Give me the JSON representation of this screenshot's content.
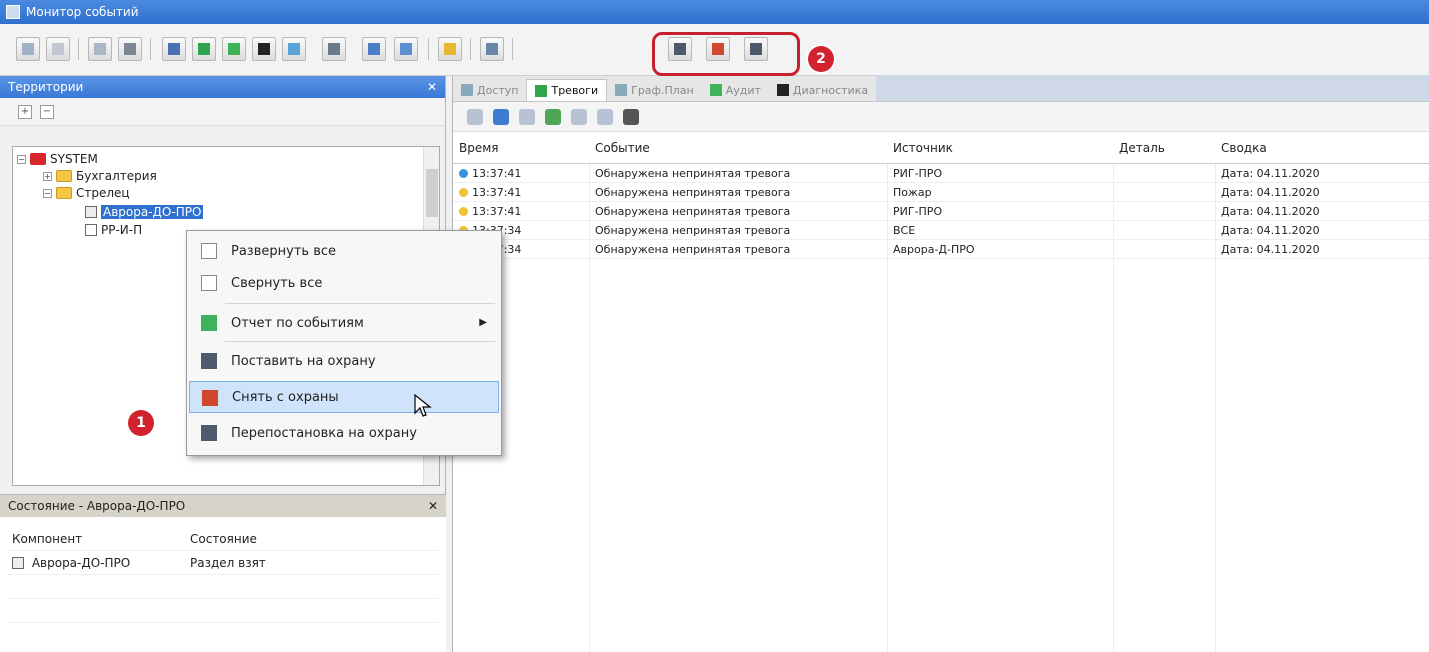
{
  "window": {
    "title": "Монитор событий"
  },
  "colors": {
    "accent": "#2f6fcf",
    "badge_red": "#d2222d",
    "folder_red": "#d9262c",
    "folder_yellow": "#f4c747"
  },
  "left_panel": {
    "title": "Территории",
    "tree": {
      "root": "SYSTEM",
      "nodes": [
        "Бухгалтерия",
        "Стрелец",
        "Аврора-ДО-ПРО",
        "РР-И-П"
      ]
    }
  },
  "context_menu": {
    "items": [
      "Развернуть все",
      "Свернуть все",
      "Отчет по событиям",
      "Поставить на охрану",
      "Снять с охраны",
      "Перепостановка на охрану"
    ],
    "hovered": "Снять с охраны"
  },
  "state_panel": {
    "title": "Состояние - Аврора-ДО-ПРО",
    "columns": [
      "Компонент",
      "Состояние"
    ],
    "rows": [
      {
        "component": "Аврора-ДО-ПРО",
        "state": "Раздел взят"
      }
    ]
  },
  "tabs": [
    "Доступ",
    "Тревоги",
    "Граф.План",
    "Аудит",
    "Диагностика"
  ],
  "events": {
    "columns": [
      "Время",
      "Событие",
      "Источник",
      "Деталь",
      "Сводка"
    ],
    "rows": [
      {
        "time": "13:37:41",
        "event": "Обнаружена непринятая тревога",
        "source": "РИГ-ПРО",
        "detail": "",
        "summary": "Дата: 04.11.2020"
      },
      {
        "time": "13:37:41",
        "event": "Обнаружена непринятая тревога",
        "source": "Пожар",
        "detail": "",
        "summary": "Дата: 04.11.2020"
      },
      {
        "time": "13:37:41",
        "event": "Обнаружена непринятая тревога",
        "source": "РИГ-ПРО",
        "detail": "",
        "summary": "Дата: 04.11.2020"
      },
      {
        "time": "13:37:34",
        "event": "Обнаружена непринятая тревога",
        "source": "ВСЕ",
        "detail": "",
        "summary": "Дата: 04.11.2020"
      },
      {
        "time": "13:37:34",
        "event": "Обнаружена непринятая тревога",
        "source": "Аврора-Д-ПРО",
        "detail": "",
        "summary": "Дата: 04.11.2020"
      }
    ]
  },
  "annotations": {
    "badge1": "1",
    "badge2": "2"
  }
}
